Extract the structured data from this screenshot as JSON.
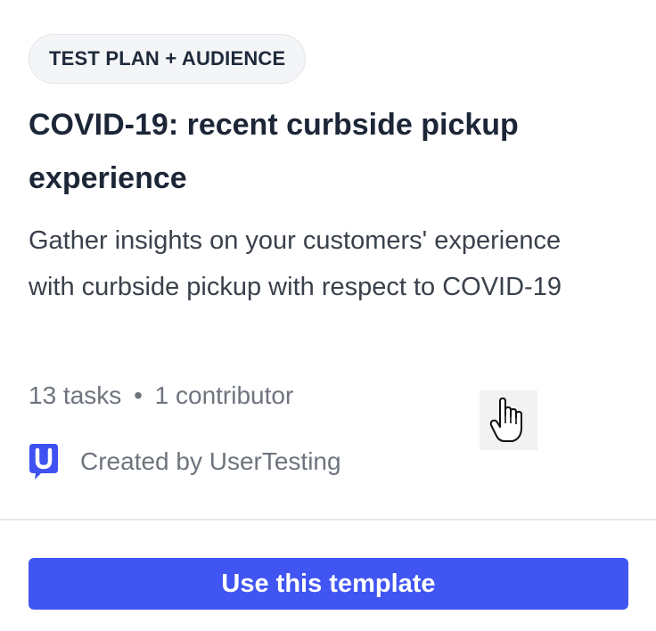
{
  "card": {
    "badge": "TEST PLAN + AUDIENCE",
    "title": "COVID-19: recent curbside pickup experience",
    "description": "Gather insights on your customers' experience with curbside pickup with respect to COVID-19",
    "meta": {
      "tasks": "13 tasks",
      "separator": "•",
      "contributors": "1 contributor"
    },
    "creator": {
      "logo_icon": "usertesting-logo-icon",
      "text": "Created by UserTesting"
    },
    "cta_label": "Use this template"
  },
  "colors": {
    "accent": "#4055f2",
    "logo": "#3f51f0",
    "title": "#1c2637",
    "muted": "#6e747d",
    "badge_bg": "#f4f5f7"
  },
  "cursor": {
    "icon": "hand-pointer-icon"
  }
}
